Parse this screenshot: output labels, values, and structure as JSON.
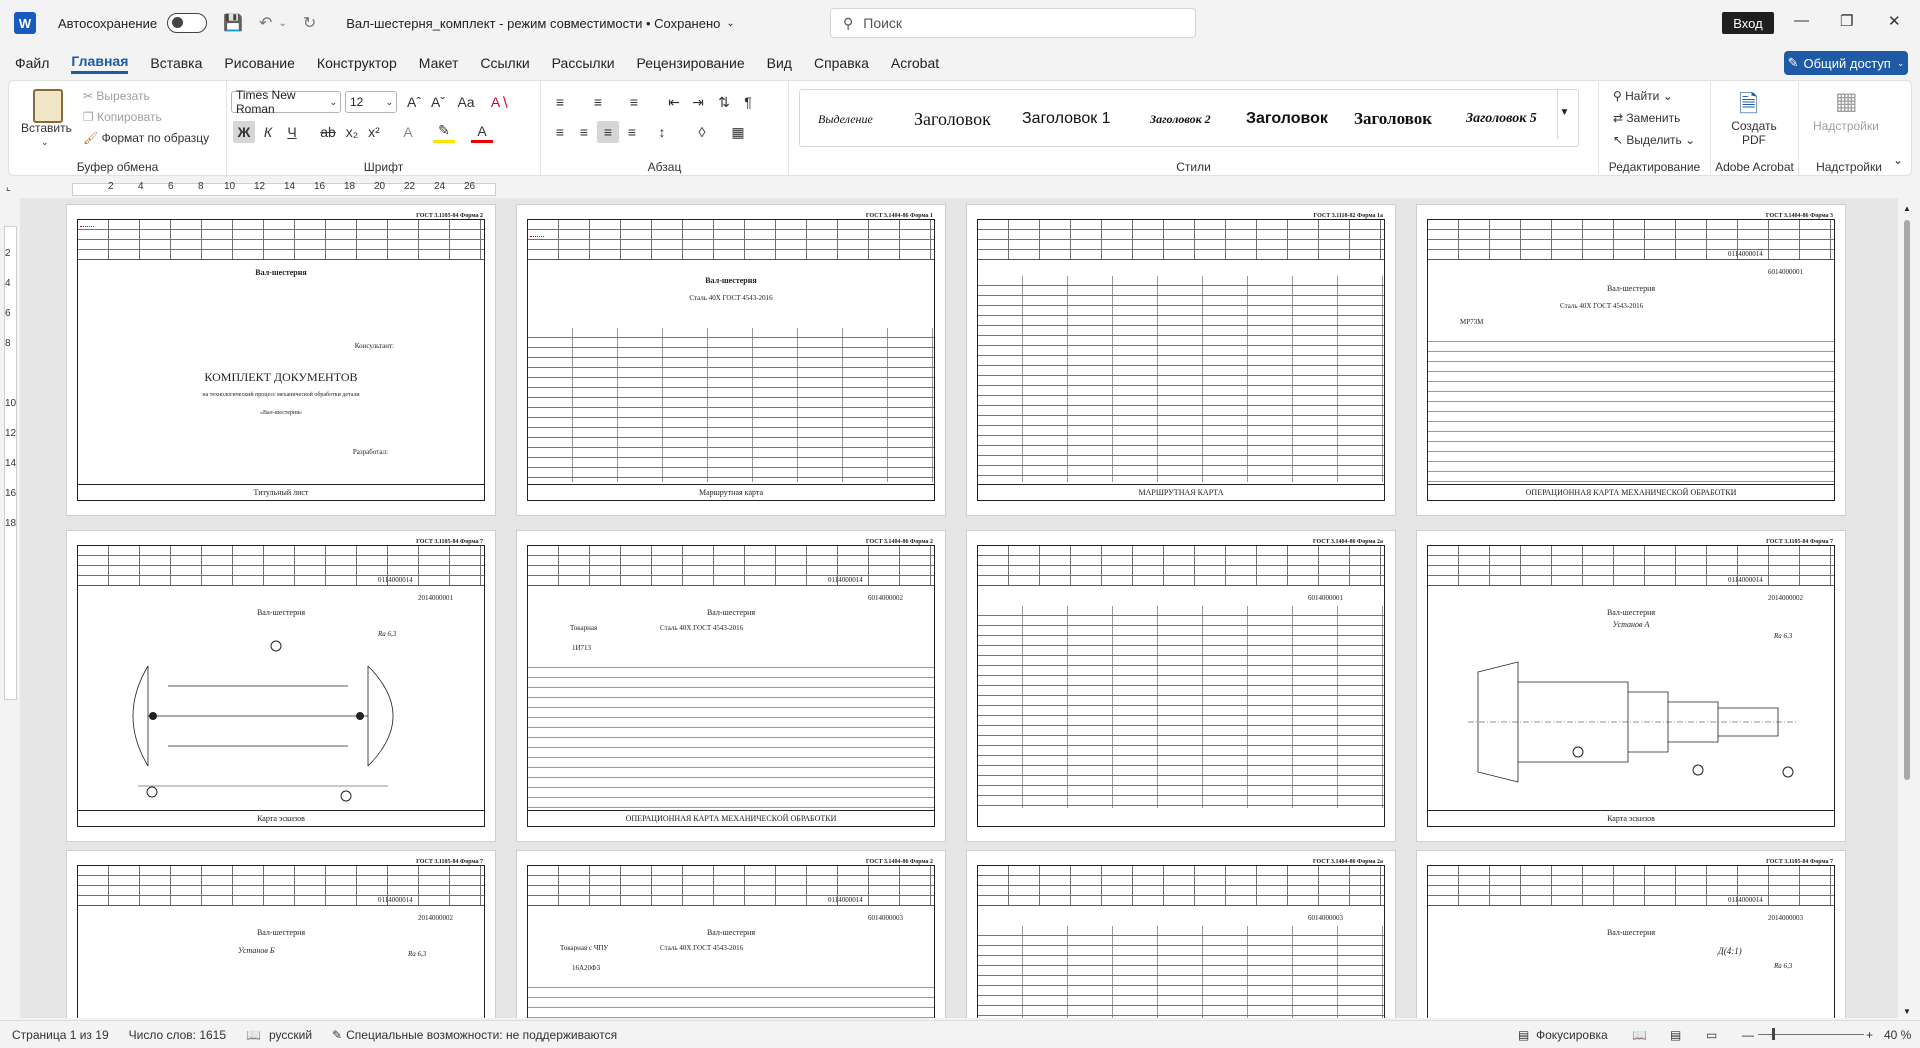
{
  "titlebar": {
    "app_letter": "W",
    "autosave_label": "Автосохранение",
    "doc_title": "Вал-шестерня_комплект  -  режим совместимости  •  Сохранено",
    "search_placeholder": "Поиск",
    "signin_label": "Вход"
  },
  "menu": {
    "tabs": [
      "Файл",
      "Главная",
      "Вставка",
      "Рисование",
      "Конструктор",
      "Макет",
      "Ссылки",
      "Рассылки",
      "Рецензирование",
      "Вид",
      "Справка",
      "Acrobat"
    ],
    "share_label": "Общий доступ"
  },
  "ribbon": {
    "clipboard": {
      "paste": "Вставить",
      "cut": "Вырезать",
      "copy": "Копировать",
      "format_painter": "Формат по образцу",
      "group": "Буфер обмена"
    },
    "font": {
      "name": "Times New Roman",
      "size": "12",
      "group": "Шрифт",
      "bold": "Ж",
      "italic": "К",
      "underline": "Ч"
    },
    "paragraph": {
      "group": "Абзац"
    },
    "styles": {
      "group": "Стили",
      "items": [
        "Выделение",
        "Заголовок",
        "Заголовок 1",
        "Заголовок 2",
        "Заголовок 3",
        "Заголовок",
        "Заголовок 5"
      ]
    },
    "editing": {
      "find": "Найти",
      "replace": "Заменить",
      "select": "Выделить",
      "group": "Редактирование"
    },
    "acrobat": {
      "create_pdf": "Создать PDF",
      "group": "Adobe Acrobat"
    },
    "addins": {
      "label": "Надстройки",
      "group": "Надстройки"
    }
  },
  "ruler": {
    "h_marks": [
      "2",
      "4",
      "6",
      "8",
      "10",
      "12",
      "14",
      "16",
      "18",
      "20",
      "22",
      "24",
      "26"
    ],
    "v_marks": [
      "2",
      "4",
      "6",
      "8",
      "10",
      "12",
      "14",
      "16",
      "18"
    ]
  },
  "pages": {
    "p1": {
      "form": "ГОСТ 3.1105-84   Форма 2",
      "part": "Вал-шестерня",
      "consultant": "Консультант:",
      "heading": "КОМПЛЕКТ ДОКУМЕНТОВ",
      "sub1": "на технологический процесс механической обработки детали",
      "sub2": "«Вал-шестерня»",
      "developer": "Разработал:",
      "footer": "Титульный лист"
    },
    "p2": {
      "form": "ГОСТ 3.1404-86   Форма 1",
      "part": "Вал-шестерня",
      "material": "Сталь 40Х ГОСТ 4543-2016",
      "footer": "Маршрутная карта"
    },
    "p3": {
      "form": "ГОСТ 3.1118-82   Форма 1а",
      "footer": "МАРШРУТНАЯ КАРТА"
    },
    "p4": {
      "form": "ГОСТ 3.1404-86   Форма 3",
      "code": "0114000014",
      "code2": "6014000001",
      "part": "Вал-шестерня",
      "material": "Сталь 40Х ГОСТ 4543-2016",
      "machine": "МР73М",
      "footer": "ОПЕРАЦИОННАЯ КАРТА МЕХАНИЧЕСКОЙ ОБРАБОТКИ"
    },
    "p5": {
      "form": "ГОСТ 3.1105-84   Форма 7",
      "code": "0114000014",
      "code2": "2014000001",
      "part": "Вал-шестерня",
      "roughness": "Ra 6,3",
      "footer": "Карта эскизов"
    },
    "p6": {
      "form": "ГОСТ 3.1404-86   Форма 2",
      "code": "0114000014",
      "code2": "6014000002",
      "part": "Вал-шестерня",
      "op": "Токарная",
      "material": "Сталь 40Х ГОСТ 4543-2016",
      "machine": "1И713",
      "footer": "ОПЕРАЦИОННАЯ КАРТА МЕХАНИЧЕСКОЙ ОБРАБОТКИ"
    },
    "p7": {
      "form": "ГОСТ 3.1404-86   Форма 2а",
      "code2": "6014000001"
    },
    "p8": {
      "form": "ГОСТ 3.1105-84   Форма 7",
      "code": "0114000014",
      "code2": "2014000002",
      "part": "Вал-шестерня",
      "setup": "Установ А",
      "roughness": "Ra 6,3",
      "footer": "Карта эскизов"
    },
    "p9": {
      "form": "ГОСТ 3.1105-84   Форма 7",
      "code": "0114000014",
      "code2": "2014000002",
      "part": "Вал-шестерня",
      "setup": "Установ Б",
      "roughness": "Ra 6,3"
    },
    "p10": {
      "form": "ГОСТ 3.1404-86   Форма 2",
      "code": "0114000014",
      "code2": "6014000003",
      "part": "Вал-шестерня",
      "op": "Токарная с ЧПУ",
      "material": "Сталь 40Х ГОСТ 4543-2016",
      "machine": "16А20Ф3"
    },
    "p11": {
      "form": "ГОСТ 3.1404-86   Форма 2а",
      "code2": "6014000003"
    },
    "p12": {
      "form": "ГОСТ 3.1105-84   Форма 7",
      "code": "0114000014",
      "code2": "2014000003",
      "part": "Вал-шестерня",
      "view": "Д(4:1)",
      "roughness": "Ra 6,3"
    }
  },
  "statusbar": {
    "page": "Страница 1 из 19",
    "words": "Число слов: 1615",
    "language": "русский",
    "accessibility": "Специальные возможности: не поддерживаются",
    "focus": "Фокусировка",
    "zoom": "40 %"
  }
}
